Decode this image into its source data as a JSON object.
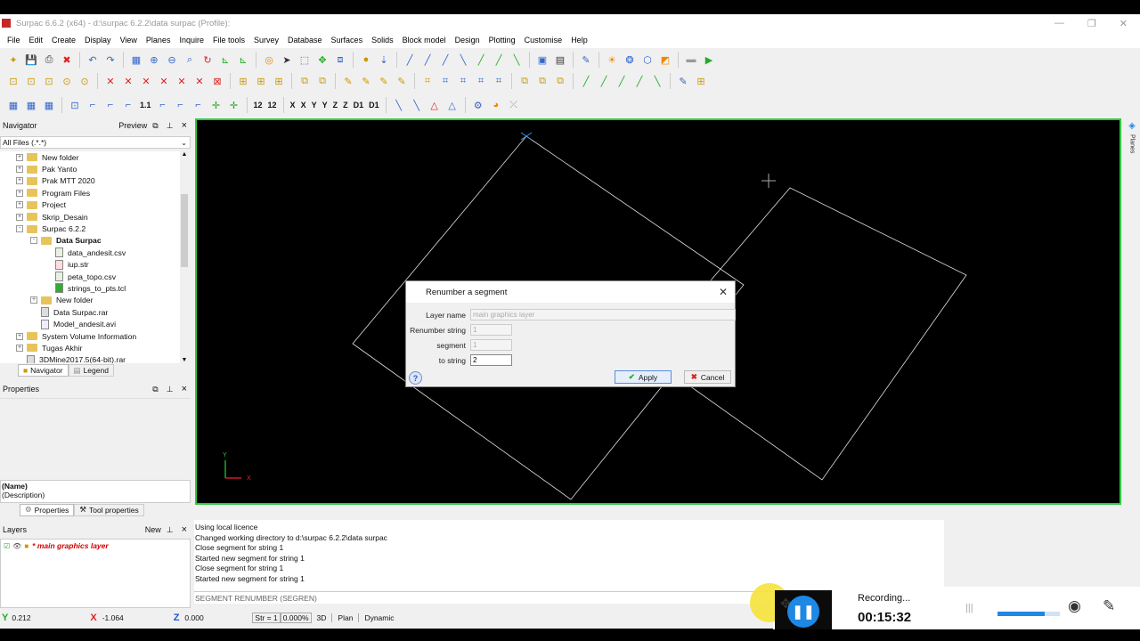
{
  "window": {
    "title": "Surpac 6.6.2 (x64) - d:\\surpac 6.2.2\\data surpac (Profile):"
  },
  "menu": [
    "File",
    "Edit",
    "Create",
    "Display",
    "View",
    "Planes",
    "Inquire",
    "File tools",
    "Survey",
    "Database",
    "Surfaces",
    "Solids",
    "Block model",
    "Design",
    "Plotting",
    "Customise",
    "Help"
  ],
  "toolbar3_labels": [
    "1.1",
    "12",
    "12",
    "X",
    "X",
    "Y",
    "Y",
    "Z",
    "Z",
    "D1",
    "D1"
  ],
  "navigator": {
    "title": "Navigator",
    "preview_label": "Preview",
    "filter": "All Files (.*.*)",
    "tree": [
      {
        "label": "New folder",
        "kind": "folder",
        "indent": 0,
        "expand": "+"
      },
      {
        "label": "Pak Yanto",
        "kind": "folder",
        "indent": 0,
        "expand": "+"
      },
      {
        "label": "Prak MTT 2020",
        "kind": "folder",
        "indent": 0,
        "expand": "+"
      },
      {
        "label": "Program Files",
        "kind": "folder",
        "indent": 0,
        "expand": "+"
      },
      {
        "label": "Project",
        "kind": "folder",
        "indent": 0,
        "expand": "+"
      },
      {
        "label": "Skrip_Desain",
        "kind": "folder",
        "indent": 0,
        "expand": "+"
      },
      {
        "label": "Surpac 6.2.2",
        "kind": "folder",
        "indent": 0,
        "expand": "-"
      },
      {
        "label": "Data Surpac",
        "kind": "folder",
        "indent": 1,
        "expand": "-",
        "bold": true
      },
      {
        "label": "data_andesit.csv",
        "kind": "csv",
        "indent": 2,
        "expand": ""
      },
      {
        "label": "iup.str",
        "kind": "str",
        "indent": 2,
        "expand": ""
      },
      {
        "label": "peta_topo.csv",
        "kind": "csv",
        "indent": 2,
        "expand": ""
      },
      {
        "label": "strings_to_pts.tcl",
        "kind": "tcl",
        "indent": 2,
        "expand": ""
      },
      {
        "label": "New folder",
        "kind": "folder",
        "indent": 1,
        "expand": "+"
      },
      {
        "label": "Data Surpac.rar",
        "kind": "rar",
        "indent": 1,
        "expand": ""
      },
      {
        "label": "Model_andesit.avi",
        "kind": "avi",
        "indent": 1,
        "expand": ""
      },
      {
        "label": "System Volume Information",
        "kind": "folder",
        "indent": 0,
        "expand": "+"
      },
      {
        "label": "Tugas Akhir",
        "kind": "folder",
        "indent": 0,
        "expand": "+"
      },
      {
        "label": "3DMine2017.5(64-bit).rar",
        "kind": "rar",
        "indent": 0,
        "expand": ""
      }
    ],
    "tabs": [
      "Navigator",
      "Legend"
    ]
  },
  "properties": {
    "title": "Properties",
    "name": "(Name)",
    "description": "(Description)",
    "tabs": [
      "Properties",
      "Tool properties"
    ]
  },
  "layers": {
    "title": "Layers",
    "new_label": "New",
    "items": [
      "* main graphics layer"
    ]
  },
  "planes_tab": "Planes",
  "dialog": {
    "title": "Renumber a segment",
    "fields": [
      {
        "label": "Layer name",
        "value": "main graphics layer"
      },
      {
        "label": "Renumber string",
        "value": "1"
      },
      {
        "label": "segment",
        "value": "1"
      },
      {
        "label": "to string",
        "value": "2"
      }
    ],
    "apply_label": "Apply",
    "cancel_label": "Cancel"
  },
  "console": {
    "lines": [
      "Using local licence",
      "Changed working directory to d:\\surpac 6.2.2\\data surpac",
      "Close segment for string 1",
      "Started new segment for string 1",
      "Close segment for string 1",
      "Started new segment for string 1"
    ],
    "command": "SEGMENT RENUMBER (SEGREN)"
  },
  "status": {
    "y_value": "0.212",
    "x_value": "-1.064",
    "z_value": "0.000",
    "str_label": "Str = 1",
    "percent": "0.000%",
    "mode_3d": "3D",
    "plan": "Plan",
    "dynamic": "Dynamic"
  },
  "recording": {
    "label": "Recording...",
    "time": "00:15:32",
    "volume_level": 0.75
  },
  "axis": {
    "y": "Y",
    "x": "X"
  },
  "colors": {
    "viewport_border": "#2ecc40",
    "layer_text": "#d00000",
    "record_button": "#1e88e5"
  }
}
